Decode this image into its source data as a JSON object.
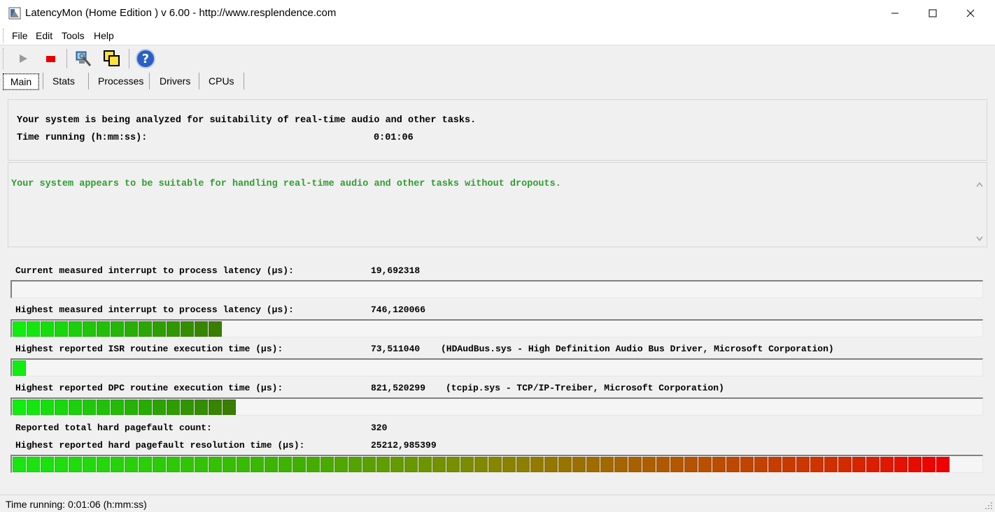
{
  "window": {
    "title": "LatencyMon  (Home Edition )  v 6.00 - http://www.resplendence.com"
  },
  "menu": {
    "items": [
      "File",
      "Edit",
      "Tools",
      "Help"
    ]
  },
  "toolbar": {
    "icons": [
      "play-icon",
      "stop-icon",
      "computer-tools-icon",
      "windows-icon",
      "help-icon"
    ]
  },
  "tabs": {
    "items": [
      "Main",
      "Stats",
      "Processes",
      "Drivers",
      "CPUs"
    ],
    "active": "Main"
  },
  "info": {
    "analyzing": "Your system is being analyzed for suitability of real-time audio and other tasks.",
    "time_label": "Time running (h:mm:ss):",
    "time_value": "0:01:06"
  },
  "verdict": {
    "text": "Your system appears to be suitable for handling real-time audio and other tasks without dropouts.",
    "color": "#2f9e2f"
  },
  "metrics": {
    "current_latency": {
      "label": "Current measured interrupt to process latency (µs):",
      "value": "19,692318",
      "level": 0
    },
    "highest_latency": {
      "label": "Highest measured interrupt to process latency (µs):",
      "value": "746,120066",
      "level": 15
    },
    "isr": {
      "label": "Highest reported ISR routine execution time (µs):",
      "value": "73,511040",
      "detail": "(HDAudBus.sys - High Definition Audio Bus Driver, Microsoft Corporation)",
      "level": 1
    },
    "dpc": {
      "label": "Highest reported DPC routine execution time (µs):",
      "value": "821,520299",
      "detail": "(tcpip.sys - TCP/IP-Treiber, Microsoft Corporation)",
      "level": 16
    },
    "pagefault_count": {
      "label": "Reported total hard pagefault count:",
      "value": "320"
    },
    "pagefault_time": {
      "label": "Highest reported hard pagefault resolution time (µs):",
      "value": "25212,985399",
      "level": 67
    }
  },
  "status": {
    "text": "Time running: 0:01:06  (h:mm:ss)"
  }
}
